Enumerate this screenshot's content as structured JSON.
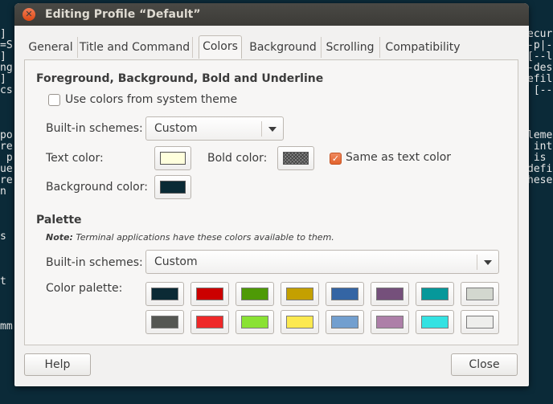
{
  "terminal": {
    "left_lines": [
      "]",
      "=S",
      "]",
      "ng",
      "]",
      "cs",
      "",
      "",
      "",
      "po",
      "re",
      " p",
      "ue",
      "re",
      "n",
      "",
      "",
      "",
      "s",
      "",
      "",
      "",
      "t",
      "",
      "",
      "",
      "mm"
    ],
    "right_lines": [
      "ecur",
      "-p|-",
      "[--l",
      "-des",
      "efil",
      " [--",
      "",
      "",
      "",
      "leme",
      " int",
      " is",
      "defi",
      "hese"
    ]
  },
  "window": {
    "title": "Editing Profile “Default”",
    "close_symbol": "✕"
  },
  "tabs": [
    {
      "label": "General"
    },
    {
      "label": "Title and Command"
    },
    {
      "label": "Colors"
    },
    {
      "label": "Background"
    },
    {
      "label": "Scrolling"
    },
    {
      "label": "Compatibility"
    }
  ],
  "fg_section": {
    "title": "Foreground, Background, Bold and Underline",
    "use_system_label": "Use colors from system theme",
    "use_system_checked": false,
    "schemes_label": "Built-in schemes:",
    "schemes_value": "Custom",
    "text_color_label": "Text color:",
    "text_color": "#ffffdd",
    "bold_color_label": "Bold color:",
    "same_as_text_label": "Same as text color",
    "same_as_text_checked": true,
    "bg_color_label": "Background color:",
    "bg_color": "#0a2a35"
  },
  "palette_section": {
    "title": "Palette",
    "note_bold": "Note:",
    "note_text": " Terminal applications have these colors available to them.",
    "schemes_label": "Built-in schemes:",
    "schemes_value": "Custom",
    "palette_label": "Color palette:",
    "colors_row1": [
      "#0b2a35",
      "#cc0000",
      "#4e9a06",
      "#c4a000",
      "#3465a4",
      "#75507b",
      "#06989a",
      "#d3d7cf"
    ],
    "colors_row2": [
      "#555753",
      "#ef2929",
      "#8ae234",
      "#fce94f",
      "#729fcf",
      "#ad7fa8",
      "#34e2e2",
      "#eeeeec"
    ]
  },
  "buttons": {
    "help": "Help",
    "close": "Close"
  }
}
